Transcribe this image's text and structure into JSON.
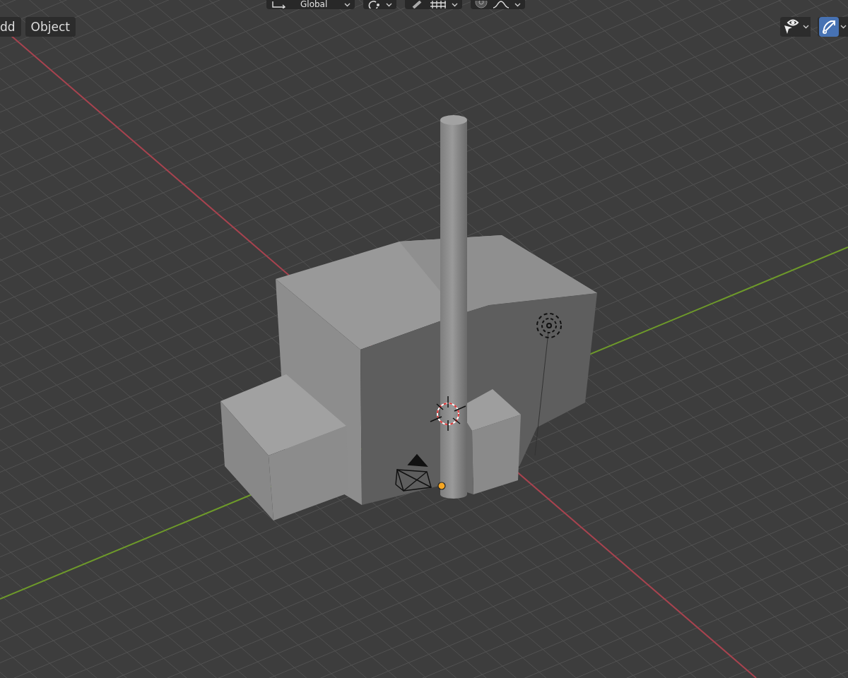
{
  "header_toolbar": {
    "orientation": {
      "label": "Global"
    },
    "snap_on": false,
    "proportional_on": false
  },
  "menus": [
    {
      "label": "dd"
    },
    {
      "label": "Object"
    }
  ],
  "overlay_toggles": [
    {
      "kind": "visibility",
      "on": false
    },
    {
      "kind": "gizmo",
      "on": true
    }
  ]
}
